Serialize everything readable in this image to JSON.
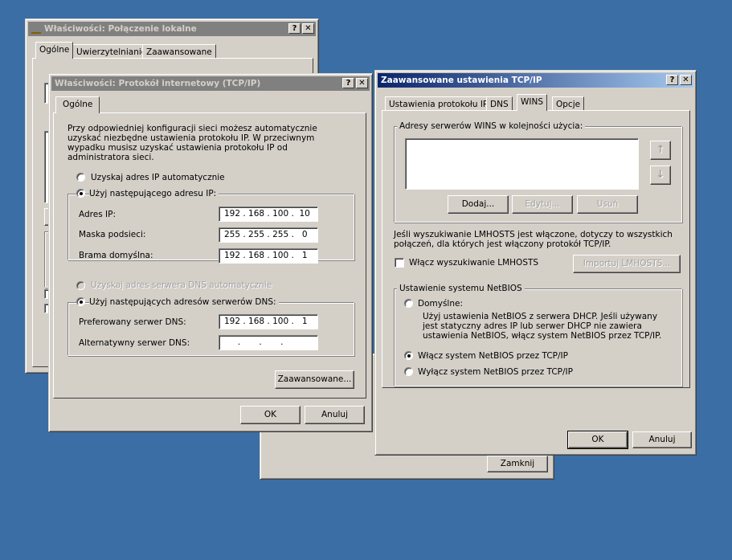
{
  "win1": {
    "title": "Właściwości: Połączenie lokalne",
    "tabs": [
      "Ogólne",
      "Uwierzytelnianie",
      "Zaawansowane"
    ]
  },
  "win2": {
    "title": "Właściwości: Protokół internetowy (TCP/IP)",
    "tab": "Ogólne",
    "intro": "Przy odpowiedniej konfiguracji sieci możesz automatycznie uzyskać niezbędne ustawienia protokołu IP. W przeciwnym wypadku musisz uzyskać ustawienia protokołu IP od administratora sieci.",
    "radio_auto_ip": "Uzyskaj adres IP automatycznie",
    "radio_manual_ip": "Użyj następującego adresu IP:",
    "ip_label": "Adres IP:",
    "ip_value": "192 . 168 . 100 .  10",
    "mask_label": "Maska podsieci:",
    "mask_value": "255 . 255 . 255 .   0",
    "gw_label": "Brama domyślna:",
    "gw_value": "192 . 168 . 100 .   1",
    "radio_auto_dns": "Uzyskaj adres serwera DNS automatycznie",
    "radio_manual_dns": "Użyj następujących adresów serwerów DNS:",
    "dns1_label": "Preferowany serwer DNS:",
    "dns1_value": "192 . 168 . 100 .   1",
    "dns2_label": "Alternatywny serwer DNS:",
    "dns2_value": "     .       .       .",
    "advanced_button": "Zaawansowane...",
    "ok_button": "OK",
    "cancel_button": "Anuluj"
  },
  "win3": {
    "title": "Zaawansowane ustawienia TCP/IP",
    "tabs": [
      "Ustawienia protokołu IP",
      "DNS",
      "WINS",
      "Opcje"
    ],
    "wins_group": "Adresy serwerów WINS w kolejności użycia:",
    "add_button": "Dodaj...",
    "edit_button": "Edytuj...",
    "remove_button": "Usuń",
    "lmhosts_info": "Jeśli wyszukiwanie LMHOSTS jest włączone, dotyczy to wszystkich połączeń, dla których jest włączony protokół TCP/IP.",
    "lmhosts_check": "Włącz wyszukiwanie LMHOSTS",
    "import_button": "Importuj LMHOSTS...",
    "netbios_group": "Ustawienie systemu NetBIOS",
    "netbios_default": "Domyślne:",
    "netbios_default_desc": "Użyj ustawienia NetBIOS z serwera DHCP. Jeśli używany jest statyczny adres IP lub serwer DHCP nie zawiera ustawienia NetBIOS, włącz system NetBIOS przez TCP/IP.",
    "netbios_enable": "Włącz system NetBIOS przez TCP/IP",
    "netbios_disable": "Wyłącz system NetBIOS przez TCP/IP",
    "ok_button": "OK",
    "cancel_button": "Anuluj"
  },
  "win4": {
    "close_button": "Zamknij"
  },
  "titlebar_buttons": {
    "help": "?",
    "close": "✕"
  }
}
